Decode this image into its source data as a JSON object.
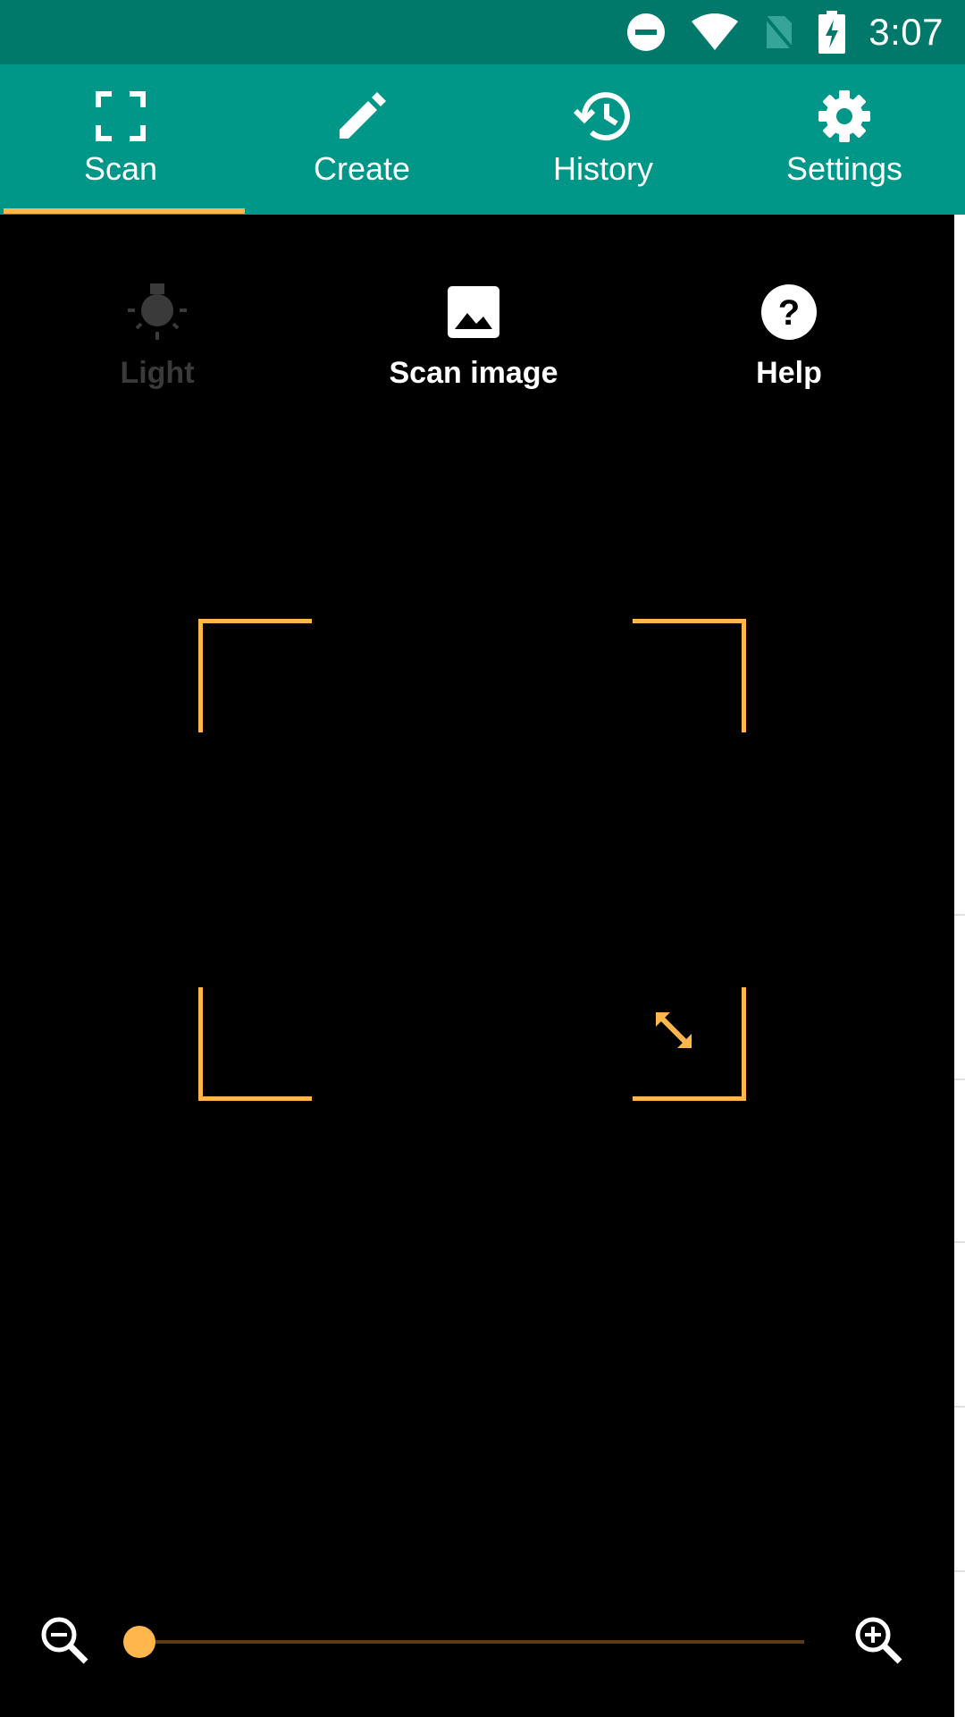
{
  "status_bar": {
    "time": "3:07",
    "icons": [
      "do-not-disturb-icon",
      "wifi-icon",
      "no-sim-icon",
      "battery-charging-icon"
    ]
  },
  "tabs": [
    {
      "label": "Scan",
      "icon": "scan-frame-icon",
      "selected": true
    },
    {
      "label": "Create",
      "icon": "pencil-icon",
      "selected": false
    },
    {
      "label": "History",
      "icon": "history-icon",
      "selected": false
    },
    {
      "label": "Settings",
      "icon": "gear-icon",
      "selected": false
    }
  ],
  "actions": [
    {
      "label": "Light",
      "icon": "flashlight-icon",
      "enabled": false
    },
    {
      "label": "Scan image",
      "icon": "image-icon",
      "enabled": true
    },
    {
      "label": "Help",
      "icon": "help-icon",
      "enabled": true
    }
  ],
  "viewfinder": {
    "resize_icon": "resize-diagonal-icon"
  },
  "zoom": {
    "level": 0,
    "min_icon": "zoom-out-icon",
    "max_icon": "zoom-in-icon"
  },
  "colors": {
    "status_bar": "#00796b",
    "tab_bar": "#009688",
    "accent": "#ffb74d",
    "background": "#000000"
  }
}
